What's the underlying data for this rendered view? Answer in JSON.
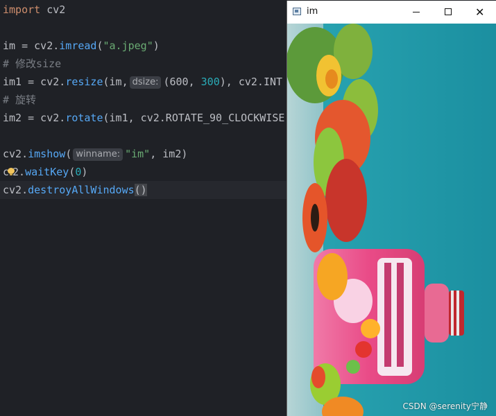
{
  "editor": {
    "line1": {
      "kw": "import",
      "rest": " cv2"
    },
    "line2": {
      "lhs": "im = cv2.",
      "fn": "imread",
      "open": "(",
      "str": "\"a.jpeg\"",
      "close": ")"
    },
    "line3": {
      "comment": "# 修改size"
    },
    "line4": {
      "lhs": "im1 = cv2.",
      "fn": "resize",
      "args": "(im,",
      "hint": "dsize:",
      "num1": "(600",
      "comma": ", ",
      "num2": "300",
      "rest": "), cv2.INT"
    },
    "line5": {
      "comment": "# 旋转"
    },
    "line6": {
      "lhs": "im2 = cv2.",
      "fn": "rotate",
      "rest": "(im1, cv2.ROTATE_90_CLOCKWISE)"
    },
    "line7": {
      "lhs": "cv2.",
      "fn": "imshow",
      "open": "(",
      "hint": "winname:",
      "str": "\"im\"",
      "rest": ", im2)"
    },
    "line8": {
      "c": "c",
      "mid": "2.",
      "fn": "waitKey",
      "open": "(",
      "num": "0",
      "close": ")"
    },
    "line9": {
      "lhs": "cv2.",
      "fn": "destroyAllWindows",
      "parens": "()"
    }
  },
  "window": {
    "title": "im",
    "close_glyph": "✕"
  },
  "watermark": "CSDN @serenity宁静",
  "colors": {
    "editor_bg": "#1f2126",
    "keyword": "#cf8e6d",
    "function": "#56a8f5",
    "string": "#6aab73",
    "number": "#2aacb8",
    "comment": "#7a7e85",
    "sky": "#1b93a6"
  },
  "icons": [
    "window-app-icon",
    "minimize-icon",
    "maximize-icon",
    "close-icon",
    "intention-bulb-icon"
  ]
}
